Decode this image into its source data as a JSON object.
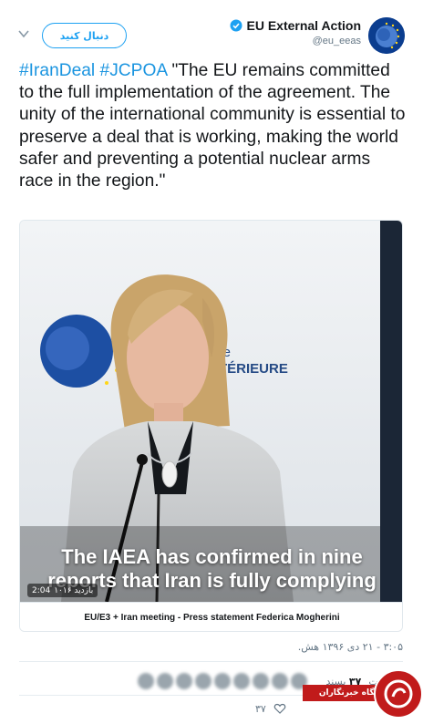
{
  "header": {
    "follow_label": "دنبال کنید",
    "account_name": "EU External Action",
    "account_handle": "@eu_eeas",
    "icons": [
      "chevron-down-icon",
      "verified-icon",
      "avatar"
    ]
  },
  "tweet": {
    "hashtag_1": "#IranDeal",
    "hashtag_2": "#JCPOA",
    "body": "\"The EU remains committed to the full implementation of the agreement. The unity of the international community is essential to preserve a deal that is working, making the world safer and preventing a potential nuclear arms race in the region.\""
  },
  "video": {
    "backdrop_text_1": "nne",
    "backdrop_text_2": "EXTÉRIEURE",
    "subtitle_line_1": "The IAEA has confirmed in nine",
    "subtitle_line_2": "reports that Iran is fully complying",
    "duration": "2:04",
    "views": "۱۰۱۶ بازدید",
    "caption": "EU/E3 + Iran meeting - Press statement Federica Mogherini"
  },
  "meta": {
    "timestamp": "۳:۰۵ - ۲۱ دی ۱۳۹۶ هش.",
    "retweets_label": "بازتوییت",
    "likes_count": "۳۷",
    "likes_label": "پسند",
    "reply_count": "۳۷"
  },
  "brand": {
    "label": "باشگاه خبرنگاران"
  },
  "colors": {
    "accent": "#1da1f2",
    "hashtag": "#1b95e0",
    "brand_red": "#c11b1b"
  }
}
